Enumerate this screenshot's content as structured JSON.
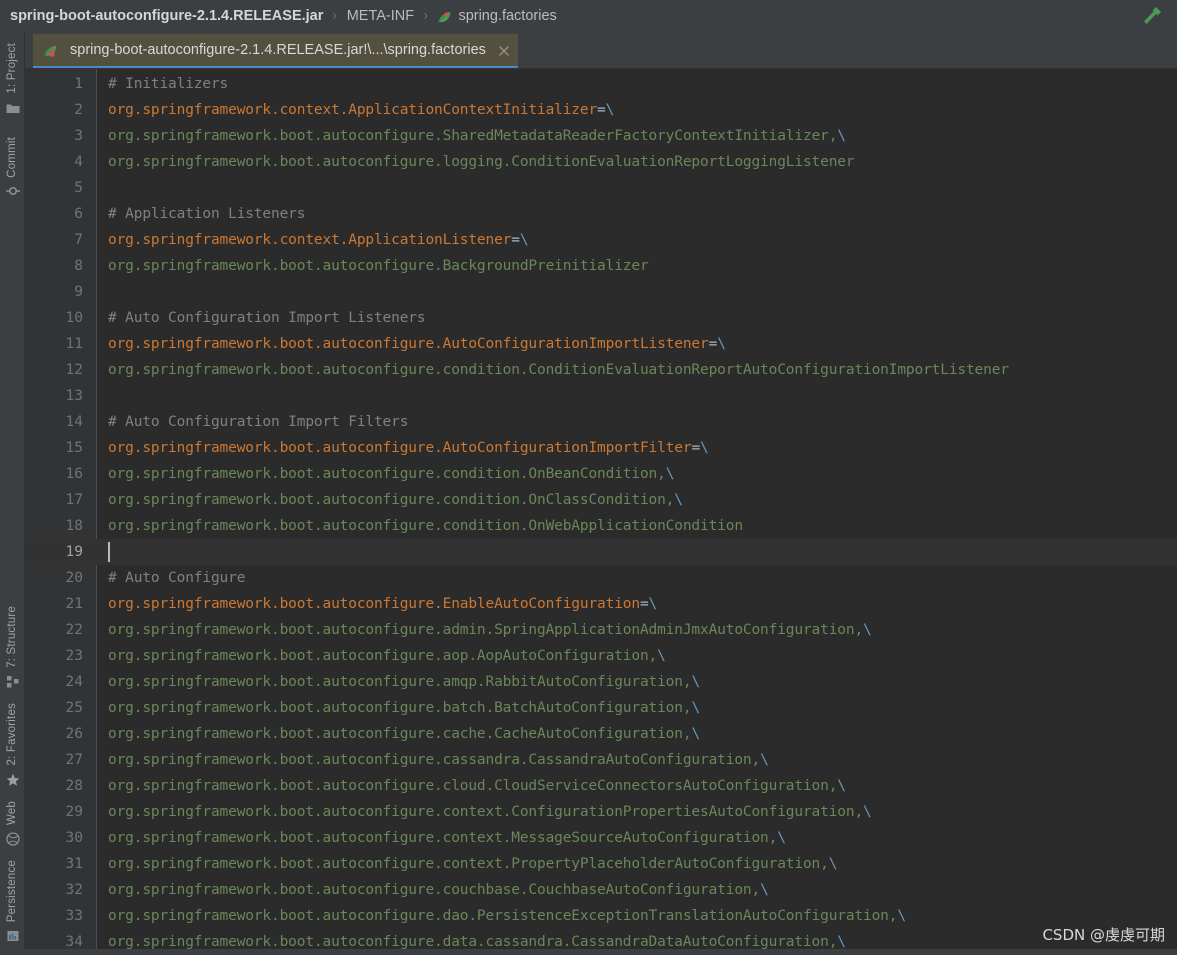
{
  "window": {
    "breadcrumb": [
      {
        "label": "spring-boot-autoconfigure-2.1.4.RELEASE.jar",
        "bold": true,
        "icon": null
      },
      {
        "label": "META-INF",
        "bold": false,
        "icon": null
      },
      {
        "label": "spring.factories",
        "bold": false,
        "icon": "leaf-icon"
      }
    ],
    "separator": "›",
    "build_icon": "hammer-icon"
  },
  "tool_stripe": {
    "top": [
      {
        "label": "1: Project",
        "mnemonic": "1",
        "icon": "folder-icon"
      },
      {
        "label": "Commit",
        "mnemonic": "",
        "icon": "commit-icon"
      }
    ],
    "bottom": [
      {
        "label": "7: Structure",
        "mnemonic": "7",
        "icon": "structure-icon"
      },
      {
        "label": "2: Favorites",
        "mnemonic": "2",
        "icon": "star-icon"
      },
      {
        "label": "Web",
        "mnemonic": "",
        "icon": "globe-icon"
      },
      {
        "label": "Persistence",
        "mnemonic": "",
        "icon": "database-icon"
      }
    ]
  },
  "editor_tab": {
    "title": "spring-boot-autoconfigure-2.1.4.RELEASE.jar!\\...\\spring.factories",
    "icon": "properties-file-icon",
    "close_icon": "close-icon",
    "selected": true
  },
  "editor": {
    "filename": "spring.factories",
    "caret_line": 19,
    "first_line": 1,
    "last_line": 34,
    "colors": {
      "background": "#2b2b2b",
      "gutter": "#313335",
      "caret_line": "#323232",
      "comment": "#808080",
      "key": "#cc7832",
      "value": "#6a8759",
      "equals": "#a9b7c6",
      "escape": "#6897bb",
      "line_number": "#717375",
      "tab_selected": "#54503f",
      "tab_underline": "#4a88c7"
    },
    "lines": [
      {
        "n": 1,
        "tokens": [
          {
            "t": "# Initializers",
            "c": "comment"
          }
        ]
      },
      {
        "n": 2,
        "tokens": [
          {
            "t": "org.springframework.context.ApplicationContextInitializer",
            "c": "key"
          },
          {
            "t": "=",
            "c": "eq"
          },
          {
            "t": "\\",
            "c": "esc"
          }
        ]
      },
      {
        "n": 3,
        "tokens": [
          {
            "t": "org.springframework.boot.autoconfigure.SharedMetadataReaderFactoryContextInitializer",
            "c": "value"
          },
          {
            "t": ",",
            "c": "value"
          },
          {
            "t": "\\",
            "c": "esc"
          }
        ]
      },
      {
        "n": 4,
        "tokens": [
          {
            "t": "org.springframework.boot.autoconfigure.logging.ConditionEvaluationReportLoggingListener",
            "c": "value"
          }
        ]
      },
      {
        "n": 5,
        "tokens": []
      },
      {
        "n": 6,
        "tokens": [
          {
            "t": "# Application Listeners",
            "c": "comment"
          }
        ]
      },
      {
        "n": 7,
        "tokens": [
          {
            "t": "org.springframework.context.ApplicationListener",
            "c": "key"
          },
          {
            "t": "=",
            "c": "eq"
          },
          {
            "t": "\\",
            "c": "esc"
          }
        ]
      },
      {
        "n": 8,
        "tokens": [
          {
            "t": "org.springframework.boot.autoconfigure.BackgroundPreinitializer",
            "c": "value"
          }
        ]
      },
      {
        "n": 9,
        "tokens": []
      },
      {
        "n": 10,
        "tokens": [
          {
            "t": "# Auto Configuration Import Listeners",
            "c": "comment"
          }
        ]
      },
      {
        "n": 11,
        "tokens": [
          {
            "t": "org.springframework.boot.autoconfigure.AutoConfigurationImportListener",
            "c": "key"
          },
          {
            "t": "=",
            "c": "eq"
          },
          {
            "t": "\\",
            "c": "esc"
          }
        ]
      },
      {
        "n": 12,
        "tokens": [
          {
            "t": "org.springframework.boot.autoconfigure.condition.ConditionEvaluationReportAutoConfigurationImportListener",
            "c": "value"
          }
        ]
      },
      {
        "n": 13,
        "tokens": []
      },
      {
        "n": 14,
        "tokens": [
          {
            "t": "# Auto Configuration Import Filters",
            "c": "comment"
          }
        ]
      },
      {
        "n": 15,
        "tokens": [
          {
            "t": "org.springframework.boot.autoconfigure.AutoConfigurationImportFilter",
            "c": "key"
          },
          {
            "t": "=",
            "c": "eq"
          },
          {
            "t": "\\",
            "c": "esc"
          }
        ]
      },
      {
        "n": 16,
        "tokens": [
          {
            "t": "org.springframework.boot.autoconfigure.condition.OnBeanCondition,",
            "c": "value"
          },
          {
            "t": "\\",
            "c": "esc"
          }
        ]
      },
      {
        "n": 17,
        "tokens": [
          {
            "t": "org.springframework.boot.autoconfigure.condition.OnClassCondition,",
            "c": "value"
          },
          {
            "t": "\\",
            "c": "esc"
          }
        ]
      },
      {
        "n": 18,
        "tokens": [
          {
            "t": "org.springframework.boot.autoconfigure.condition.OnWebApplicationCondition",
            "c": "value"
          }
        ]
      },
      {
        "n": 19,
        "tokens": []
      },
      {
        "n": 20,
        "tokens": [
          {
            "t": "# Auto Configure",
            "c": "comment"
          }
        ]
      },
      {
        "n": 21,
        "tokens": [
          {
            "t": "org.springframework.boot.autoconfigure.EnableAutoConfiguration",
            "c": "key"
          },
          {
            "t": "=",
            "c": "eq"
          },
          {
            "t": "\\",
            "c": "esc"
          }
        ]
      },
      {
        "n": 22,
        "tokens": [
          {
            "t": "org.springframework.boot.autoconfigure.admin.SpringApplicationAdminJmxAutoConfiguration,",
            "c": "value"
          },
          {
            "t": "\\",
            "c": "esc"
          }
        ]
      },
      {
        "n": 23,
        "tokens": [
          {
            "t": "org.springframework.boot.autoconfigure.aop.AopAutoConfiguration,",
            "c": "value"
          },
          {
            "t": "\\",
            "c": "esc"
          }
        ]
      },
      {
        "n": 24,
        "tokens": [
          {
            "t": "org.springframework.boot.autoconfigure.amqp.RabbitAutoConfiguration,",
            "c": "value"
          },
          {
            "t": "\\",
            "c": "esc"
          }
        ]
      },
      {
        "n": 25,
        "tokens": [
          {
            "t": "org.springframework.boot.autoconfigure.batch.BatchAutoConfiguration,",
            "c": "value"
          },
          {
            "t": "\\",
            "c": "esc"
          }
        ]
      },
      {
        "n": 26,
        "tokens": [
          {
            "t": "org.springframework.boot.autoconfigure.cache.CacheAutoConfiguration,",
            "c": "value"
          },
          {
            "t": "\\",
            "c": "esc"
          }
        ]
      },
      {
        "n": 27,
        "tokens": [
          {
            "t": "org.springframework.boot.autoconfigure.cassandra.CassandraAutoConfiguration,",
            "c": "value"
          },
          {
            "t": "\\",
            "c": "esc"
          }
        ]
      },
      {
        "n": 28,
        "tokens": [
          {
            "t": "org.springframework.boot.autoconfigure.cloud.CloudServiceConnectorsAutoConfiguration,",
            "c": "value"
          },
          {
            "t": "\\",
            "c": "esc"
          }
        ]
      },
      {
        "n": 29,
        "tokens": [
          {
            "t": "org.springframework.boot.autoconfigure.context.ConfigurationPropertiesAutoConfiguration,",
            "c": "value"
          },
          {
            "t": "\\",
            "c": "esc"
          }
        ]
      },
      {
        "n": 30,
        "tokens": [
          {
            "t": "org.springframework.boot.autoconfigure.context.MessageSourceAutoConfiguration,",
            "c": "value"
          },
          {
            "t": "\\",
            "c": "esc"
          }
        ]
      },
      {
        "n": 31,
        "tokens": [
          {
            "t": "org.springframework.boot.autoconfigure.context.PropertyPlaceholderAutoConfiguration,",
            "c": "value"
          },
          {
            "t": "\\",
            "c": "esc"
          }
        ]
      },
      {
        "n": 32,
        "tokens": [
          {
            "t": "org.springframework.boot.autoconfigure.couchbase.CouchbaseAutoConfiguration,",
            "c": "value"
          },
          {
            "t": "\\",
            "c": "esc"
          }
        ]
      },
      {
        "n": 33,
        "tokens": [
          {
            "t": "org.springframework.boot.autoconfigure.dao.PersistenceExceptionTranslationAutoConfiguration,",
            "c": "value"
          },
          {
            "t": "\\",
            "c": "esc"
          }
        ]
      },
      {
        "n": 34,
        "tokens": [
          {
            "t": "org.springframework.boot.autoconfigure.data.cassandra.CassandraDataAutoConfiguration,",
            "c": "value"
          },
          {
            "t": "\\",
            "c": "esc"
          }
        ]
      }
    ]
  },
  "watermark": {
    "text": "CSDN @虔虔可期"
  }
}
